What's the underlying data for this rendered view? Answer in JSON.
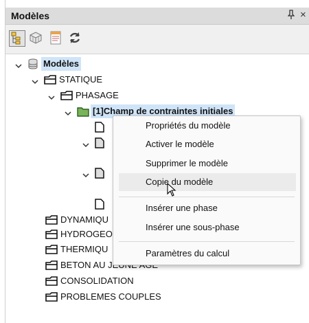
{
  "panel": {
    "title": "Modèles",
    "pin_glyph": "ꟷ",
    "close_glyph": "×"
  },
  "toolbar": {
    "buttons": [
      "tree-view-icon",
      "3d-model-icon",
      "properties-icon",
      "refresh-icon"
    ]
  },
  "tree": {
    "root": "Modèles",
    "statique": "STATIQUE",
    "phasage": "PHASAGE",
    "champ": "[1]Champ de contraintes initiales",
    "dynamique": "DYNAMIQU",
    "hydrogeo": "HYDROGEO",
    "thermique": "THERMIQU",
    "beton": "BETON AU JEUNE AGE",
    "consolidation": "CONSOLIDATION",
    "problemes": "PROBLEMES COUPLES"
  },
  "context_menu": {
    "items": [
      "Propriétés du modèle",
      "Activer le modèle",
      "Supprimer le modèle",
      "Copie du modèle",
      "Insérer une phase",
      "Insérer une sous-phase",
      "Paramètres du calcul"
    ],
    "hovered_index": 3
  },
  "colors": {
    "highlight": "#cfe4f8",
    "folder_green": "#78b45a",
    "titlebar": "#dcdcdc"
  }
}
